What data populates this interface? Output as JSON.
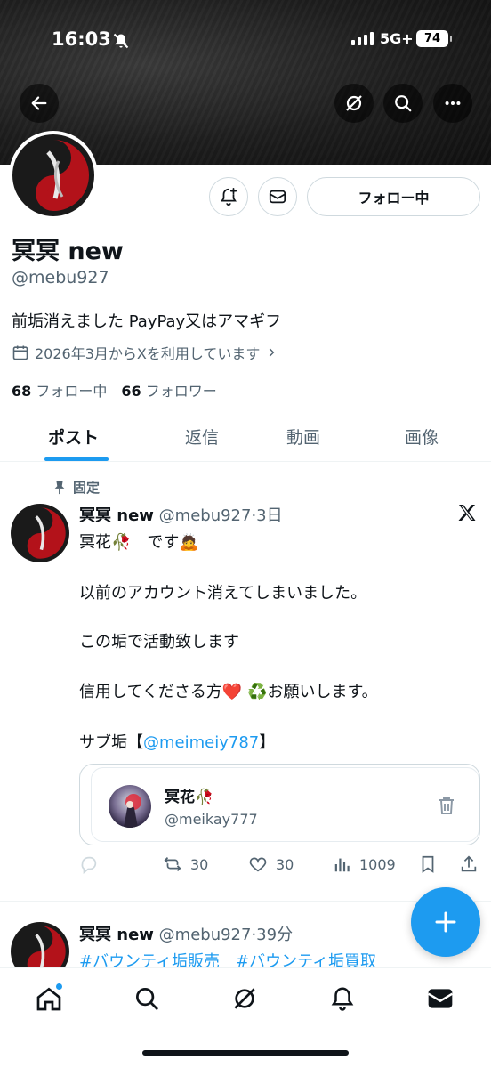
{
  "status_bar": {
    "time": "16:03",
    "network": "5G+",
    "battery": "74"
  },
  "profile": {
    "name": "冥冥 new",
    "handle": "@mebu927",
    "bio": "前垢消えました PayPay又はアマギフ",
    "joined": "2026年3月からXを利用しています",
    "following_count": "68",
    "following_label": "フォロー中",
    "followers_count": "66",
    "followers_label": "フォロワー",
    "follow_button": "フォロー中"
  },
  "tabs": [
    "ポスト",
    "返信",
    "動画",
    "画像"
  ],
  "pinned_post": {
    "pinned_label": "固定",
    "author_name": "冥冥 new",
    "author_meta": "@mebu927·3日",
    "lines": [
      "冥花🥀　です🙇",
      "以前のアカウント消えてしまいました。",
      "この垢で活動致します",
      "信用してくださる方❤️ ♻️お願いします。"
    ],
    "sub_prefix": " サブ垢【",
    "sub_link": "@meimeiy787",
    "sub_suffix": "】",
    "quote": {
      "name": "冥花🥀",
      "handle": "@meikay777"
    },
    "stats": {
      "retweets": "30",
      "likes": "30",
      "views": "1009"
    }
  },
  "second_post": {
    "author_name": "冥冥 new",
    "author_meta": "@mebu927·39分",
    "hashtags": "#バウンティ垢販売　#バウンティ垢買取"
  },
  "colors": {
    "accent": "#1d9bf0",
    "text": "#0f1419",
    "muted": "#536471"
  }
}
